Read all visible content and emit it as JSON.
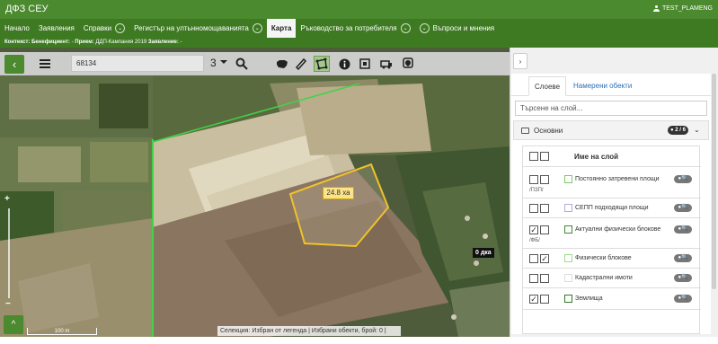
{
  "app": {
    "title": "ДФЗ СЕУ",
    "user": "TEST_PLAMENG"
  },
  "nav": {
    "items": [
      {
        "label": "Начало"
      },
      {
        "label": "Заявления"
      },
      {
        "label": "Справки"
      },
      {
        "label": "Регистър на ултьнномощаванията"
      },
      {
        "label": "Карта"
      },
      {
        "label": "Ръководство за потребителя"
      },
      {
        "label": "Въпроси и мнения"
      }
    ]
  },
  "context": {
    "context_label": "Контекст:",
    "beneficiary_label": "Бенефициент:",
    "beneficiary_value": "-",
    "reception_label": "Прием:",
    "reception_value": "ДДП-Кампания 2019",
    "application_label": "Заявление:",
    "application_value": "-"
  },
  "toolbar": {
    "search_value": "68134",
    "result_count": "3"
  },
  "map": {
    "area_label": "24.8 ха",
    "dka_label": "0 дка",
    "scale_label": "100 m",
    "zoom_plus": "+",
    "zoom_minus": "−",
    "status": {
      "selection_label": "Селекция:",
      "selection_value": "Избран от легенда",
      "separator": "|",
      "selected_label": "Избрани обекти, брой:",
      "selected_count": "0",
      "end": "|"
    }
  },
  "panel": {
    "tabs": [
      {
        "label": "Слоеве"
      },
      {
        "label": "Намерени обекти"
      }
    ],
    "search_placeholder": "Търсене на слой...",
    "group": {
      "name": "Основни",
      "badge": "2 / 6"
    },
    "layers_header": "Име на слой",
    "layers": [
      {
        "name": "Постоянно затревени площи",
        "code": "/ПЗП/",
        "checked": false,
        "color": "#7ec86a"
      },
      {
        "name": "СЕПП подходящи площи",
        "code": "",
        "checked": false,
        "color": "#b7a7e0"
      },
      {
        "name": "Актуални физически блокове",
        "code": "/ФБ/",
        "checked": true,
        "color": "#3b8a30"
      },
      {
        "name": "Физически блокове",
        "code": "",
        "checked": false,
        "color": "#9fdc8d"
      },
      {
        "name": "Кадастрални имоти",
        "code": "",
        "checked": false,
        "color": "#dddddd"
      },
      {
        "name": "Землища",
        "code": "",
        "checked": true,
        "color": "#2f7a26"
      }
    ]
  }
}
